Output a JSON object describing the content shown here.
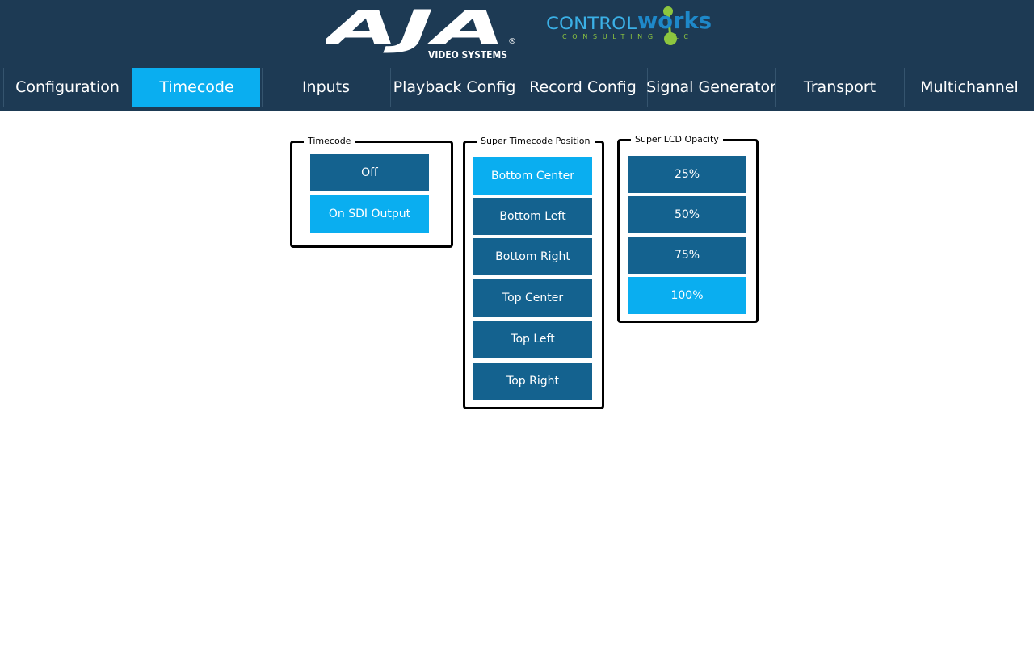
{
  "header": {
    "aja_logo": {
      "wordmark": "AJA",
      "tagline": "VIDEO SYSTEMS",
      "registered": "®"
    },
    "controlworks_logo": {
      "control": "CONTROL",
      "works": "works",
      "sub": "CONSULTING LLC"
    }
  },
  "tabs": [
    {
      "label": "Configuration"
    },
    {
      "label": "Timecode"
    },
    {
      "label": "Inputs"
    },
    {
      "label": "Playback Config"
    },
    {
      "label": "Record Config"
    },
    {
      "label": "Signal Generator"
    },
    {
      "label": "Transport"
    },
    {
      "label": "Multichannel"
    }
  ],
  "active_tab": "Timecode",
  "groups": {
    "timecode": {
      "title": "Timecode",
      "options": [
        "Off",
        "On SDI Output"
      ],
      "selected": "On SDI Output"
    },
    "position": {
      "title": "Super Timecode Position",
      "options": [
        "Bottom Center",
        "Bottom Left",
        "Bottom Right",
        "Top Center",
        "Top Left",
        "Top Right"
      ],
      "selected": "Bottom Center"
    },
    "opacity": {
      "title": "Super LCD Opacity",
      "options": [
        "25%",
        "50%",
        "75%",
        "100%"
      ],
      "selected": "100%"
    }
  },
  "colors": {
    "header_bg": "#1d3a54",
    "accent": "#0aaef0",
    "button": "#14628f",
    "cw_green": "#8dc63f"
  }
}
